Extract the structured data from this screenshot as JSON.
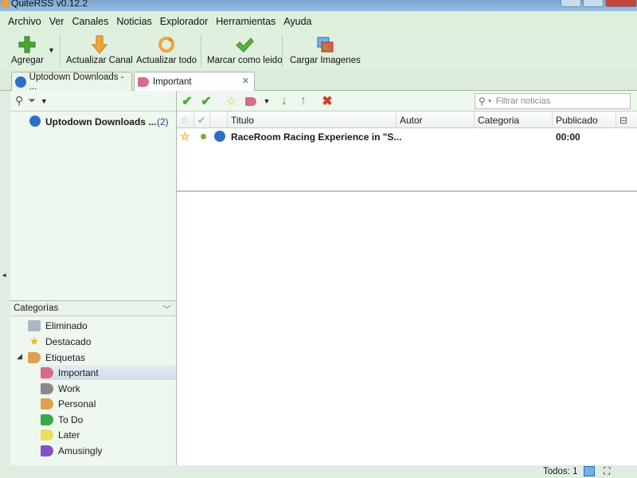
{
  "window": {
    "title": "QuiteRSS v0.12.2"
  },
  "menu": [
    "Archivo",
    "Ver",
    "Canales",
    "Noticias",
    "Explorador",
    "Herramientas",
    "Ayuda"
  ],
  "toolbar": {
    "add": "Agregar",
    "update_feed": "Actualizar Canal",
    "update_all": "Actualizar todo",
    "mark_read": "Marcar como leido",
    "load_images": "Cargar Imagenes"
  },
  "tabs": [
    {
      "label": "Uptodown Downloads - ..."
    },
    {
      "label": "Important"
    }
  ],
  "feeds": [
    {
      "name": "Uptodown Downloads ...",
      "count": "(2)"
    }
  ],
  "categories": {
    "header": "Categorías",
    "items": [
      {
        "label": "Eliminado",
        "icon": "trash-icon"
      },
      {
        "label": "Destacado",
        "icon": "star-icon"
      },
      {
        "label": "Etiquetas",
        "icon": "label-icon"
      }
    ],
    "labels": [
      {
        "label": "Important",
        "color": "#d86a8a",
        "selected": true
      },
      {
        "label": "Work",
        "color": "#8a8a8a"
      },
      {
        "label": "Personal",
        "color": "#e0a050"
      },
      {
        "label": "To Do",
        "color": "#3aa84a"
      },
      {
        "label": "Later",
        "color": "#e8df5a"
      },
      {
        "label": "Amusingly",
        "color": "#8a4fc4"
      }
    ]
  },
  "news": {
    "filter_placeholder": "Filtrar noticias",
    "columns": {
      "title": "Titulo",
      "author": "Autor",
      "category": "Categoria",
      "published": "Publicado"
    },
    "rows": [
      {
        "title": "RaceRoom Racing Experience in \"S...",
        "author": "",
        "category": "",
        "published": "00:00"
      }
    ]
  },
  "status": {
    "text": "Todos: 1"
  },
  "colors": {
    "accent_green": "#4aa832",
    "background": "#dfeee0"
  }
}
